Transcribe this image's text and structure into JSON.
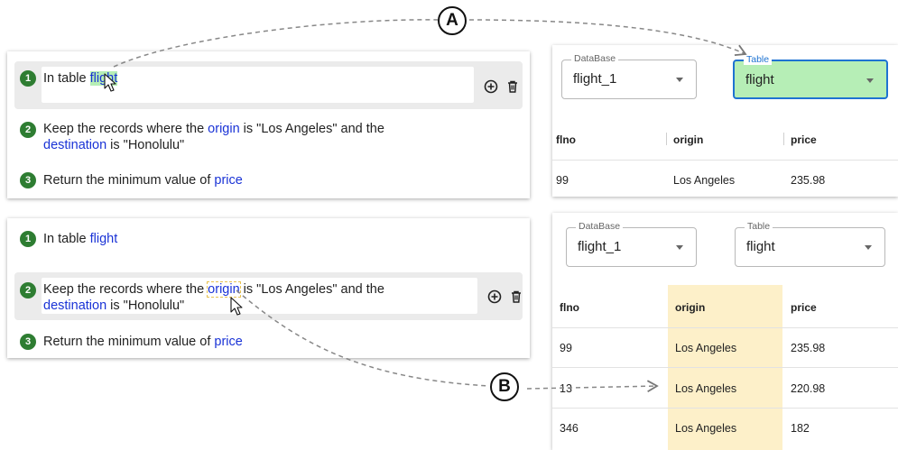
{
  "top": {
    "steps": [
      {
        "n": "1",
        "pre": "In table ",
        "kw": "flight"
      },
      {
        "n": "2",
        "pre": "Keep the records where the ",
        "kw1": "origin",
        "mid": " is \"Los Angeles\" and the",
        "kw2": "destination",
        "post": " is \"Honolulu\""
      },
      {
        "n": "3",
        "pre": "Return the minimum value of ",
        "kw": "price"
      }
    ],
    "db_label": "DataBase",
    "db_value": "flight_1",
    "table_label": "Table",
    "table_value": "flight",
    "columns": [
      "flno",
      "origin",
      "price"
    ],
    "rows": [
      [
        "99",
        "Los Angeles",
        "235.98"
      ]
    ]
  },
  "bottom": {
    "steps": [
      {
        "n": "1",
        "pre": "In table ",
        "kw": "flight"
      },
      {
        "n": "2",
        "pre": "Keep the records where the ",
        "kw1": "origin",
        "mid": " is \"Los Angeles\" and the",
        "kw2": "destination",
        "post": " is \"Honolulu\""
      },
      {
        "n": "3",
        "pre": "Return the minimum value of ",
        "kw": "price"
      }
    ],
    "db_label": "DataBase",
    "db_value": "flight_1",
    "table_label": "Table",
    "table_value": "flight",
    "columns": [
      "flno",
      "origin",
      "price"
    ],
    "rows": [
      [
        "99",
        "Los Angeles",
        "235.98"
      ],
      [
        "13",
        "Los Angeles",
        "220.98"
      ],
      [
        "346",
        "Los Angeles",
        "182"
      ]
    ]
  },
  "callouts": {
    "a": "A",
    "b": "B"
  },
  "colors": {
    "keyword": "#1a33d6",
    "step_badge": "#2e7d32",
    "highlight_green": "#b6eeb6",
    "highlight_yellow": "#fdf0c9",
    "focus_blue": "#1e73d2"
  },
  "icons": [
    "add-circle-icon",
    "trash-icon",
    "cursor-icon",
    "dropdown-caret-icon"
  ]
}
